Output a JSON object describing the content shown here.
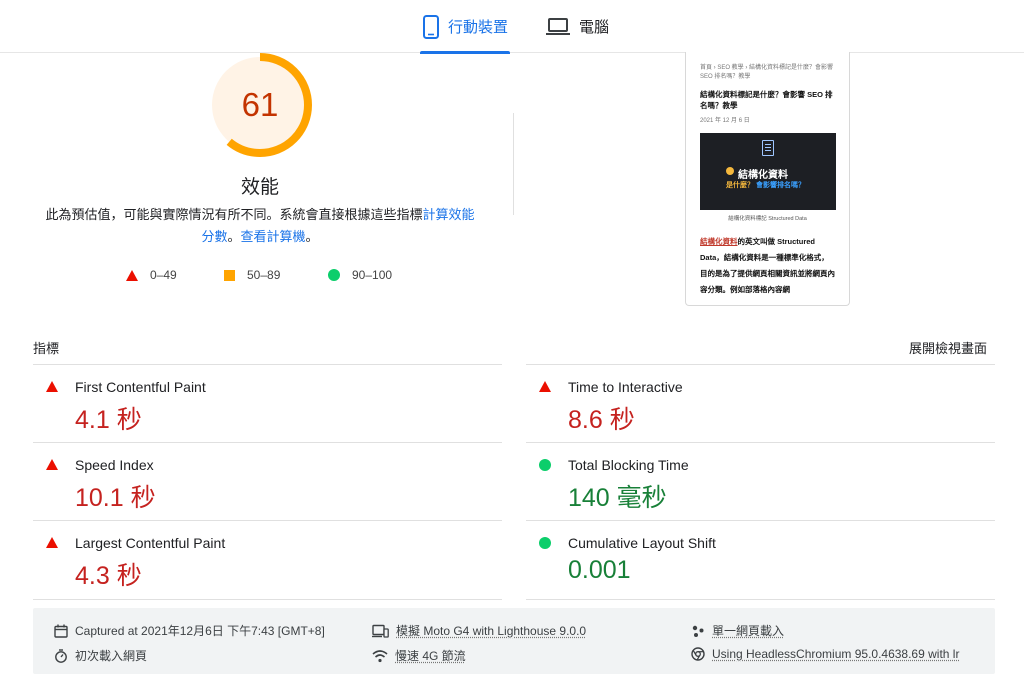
{
  "tabs": {
    "mobile": "行動裝置",
    "desktop": "電腦"
  },
  "score": {
    "value": "61",
    "fraction": 0.61,
    "color": "#ffa400",
    "title": "效能",
    "desc_prefix": "此為預估值，可能與實際情況有所不同。系統會直接根據這些指標",
    "desc_link1": "計算效能分數",
    "desc_sep": "。",
    "desc_link2": "查看計算機",
    "desc_end": "。"
  },
  "legend": {
    "bad": "0–49",
    "average": "50–89",
    "good": "90–100"
  },
  "thumbnail": {
    "crumb": "首頁 › SEO 教學 › 結構化資料標記是什麼？會影響 SEO 排名嗎？教學",
    "title": "結構化資料標記是什麼？會影響 SEO 排名嗎？教學",
    "date": "2021 年 12 月 6 日",
    "hero_title": "結構化資料",
    "hero_sub_a": "是什麼？",
    "hero_sub_b": "會影響排名嗎？",
    "caption": "結構化資料標記 Structured Data",
    "para_highlight": "結構化資料",
    "para_text": "的英文叫做 Structured Data，結構化資料是一種標準化格式，目的是為了提供網頁相關資訊並將網頁內容分類。例如部落格內容網"
  },
  "metrics_header": {
    "title": "指標",
    "expand": "展開檢視畫面"
  },
  "metrics": [
    {
      "name": "First Contentful Paint",
      "value": "4.1 秒",
      "rating": "bad"
    },
    {
      "name": "Time to Interactive",
      "value": "8.6 秒",
      "rating": "bad"
    },
    {
      "name": "Speed Index",
      "value": "10.1 秒",
      "rating": "bad"
    },
    {
      "name": "Total Blocking Time",
      "value": "140 毫秒",
      "rating": "good"
    },
    {
      "name": "Largest Contentful Paint",
      "value": "4.3 秒",
      "rating": "bad"
    },
    {
      "name": "Cumulative Layout Shift",
      "value": "0.001",
      "rating": "good"
    }
  ],
  "footer": {
    "captured": "Captured at 2021年12月6日 下午7:43 [GMT+8]",
    "device": "模擬 Moto G4 with Lighthouse 9.0.0",
    "session": "單一網頁載入",
    "load": "初次載入網頁",
    "throttle": "慢速 4G 節流",
    "browser": "Using HeadlessChromium 95.0.4638.69 with lr"
  },
  "colors": {
    "accent": "#1a73e8",
    "bad": "#eb0f00",
    "average": "#ffa400",
    "good": "#0cce6b"
  }
}
